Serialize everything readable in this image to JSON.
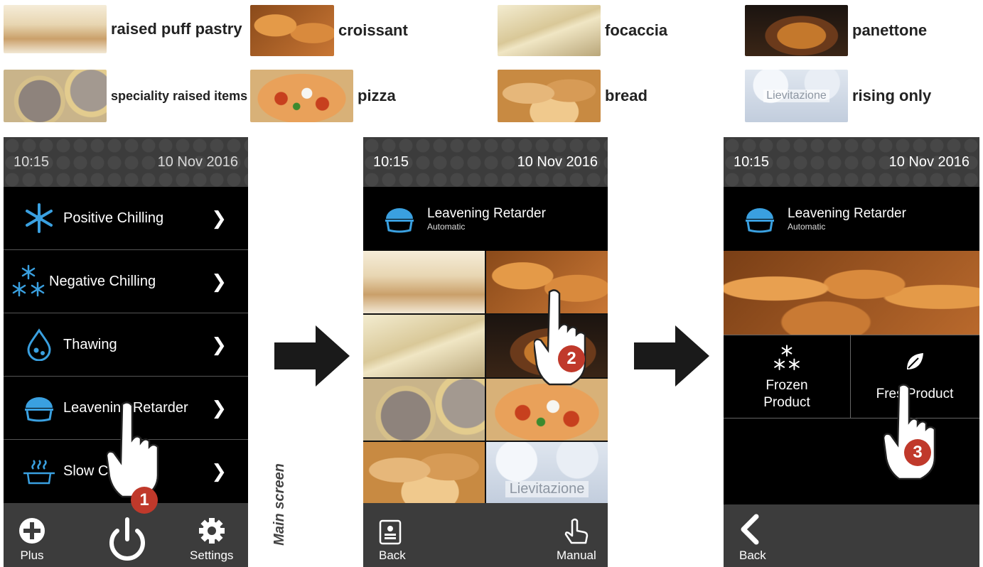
{
  "legend": [
    {
      "label": "raised puff pastry",
      "color1": "#efe3cc",
      "color2": "#c9a978"
    },
    {
      "label": "croissant",
      "color1": "#d98a3d",
      "color2": "#8a4a1a"
    },
    {
      "label": "focaccia",
      "color1": "#f0e6c4",
      "color2": "#c6b486"
    },
    {
      "label": "panettone",
      "color1": "#6b3a1b",
      "color2": "#c4782c"
    },
    {
      "label": "speciality raised items",
      "color1": "#9c8f86",
      "color2": "#d6c08a"
    },
    {
      "label": "pizza",
      "color1": "#e9c27a",
      "color2": "#c7401e"
    },
    {
      "label": "bread",
      "color1": "#e6b77a",
      "color2": "#c88a42"
    },
    {
      "label": "rising only",
      "color1": "#c9d4e2",
      "color2": "#eef2f7",
      "overlay_text": "Lievitazione"
    }
  ],
  "screen1": {
    "time": "10:15",
    "date": "10 Nov 2016",
    "menu": [
      {
        "label": "Positive Chilling",
        "icon": "snowflake-icon"
      },
      {
        "label": "Negative Chilling",
        "icon": "snowflake-cluster-icon"
      },
      {
        "label": "Thawing",
        "icon": "drop-icon"
      },
      {
        "label": "Leavening Retarder",
        "icon": "dough-bowl-icon"
      },
      {
        "label": "Slow Co",
        "icon": "cooking-pot-icon"
      }
    ],
    "plus_label": "Plus",
    "settings_label": "Settings",
    "step": "1",
    "side_caption": "Main screen"
  },
  "screen2": {
    "time": "10:15",
    "date": "10 Nov 2016",
    "program_title": "Leavening Retarder",
    "program_mode": "Automatic",
    "tile_overlay": "Lievitazione",
    "back_label": "Back",
    "manual_label": "Manual",
    "step": "2"
  },
  "screen3": {
    "time": "10:15",
    "date": "10 Nov 2016",
    "program_title": "Leavening Retarder",
    "program_mode": "Automatic",
    "frozen_line1": "Frozen",
    "frozen_line2": "Product",
    "fresh_label": "Fres Product",
    "back_label": "Back",
    "step": "3"
  },
  "colors": {
    "accent_blue": "#3aa0e0",
    "badge_red": "#c0392b",
    "topbar": "#3c3c3c"
  }
}
